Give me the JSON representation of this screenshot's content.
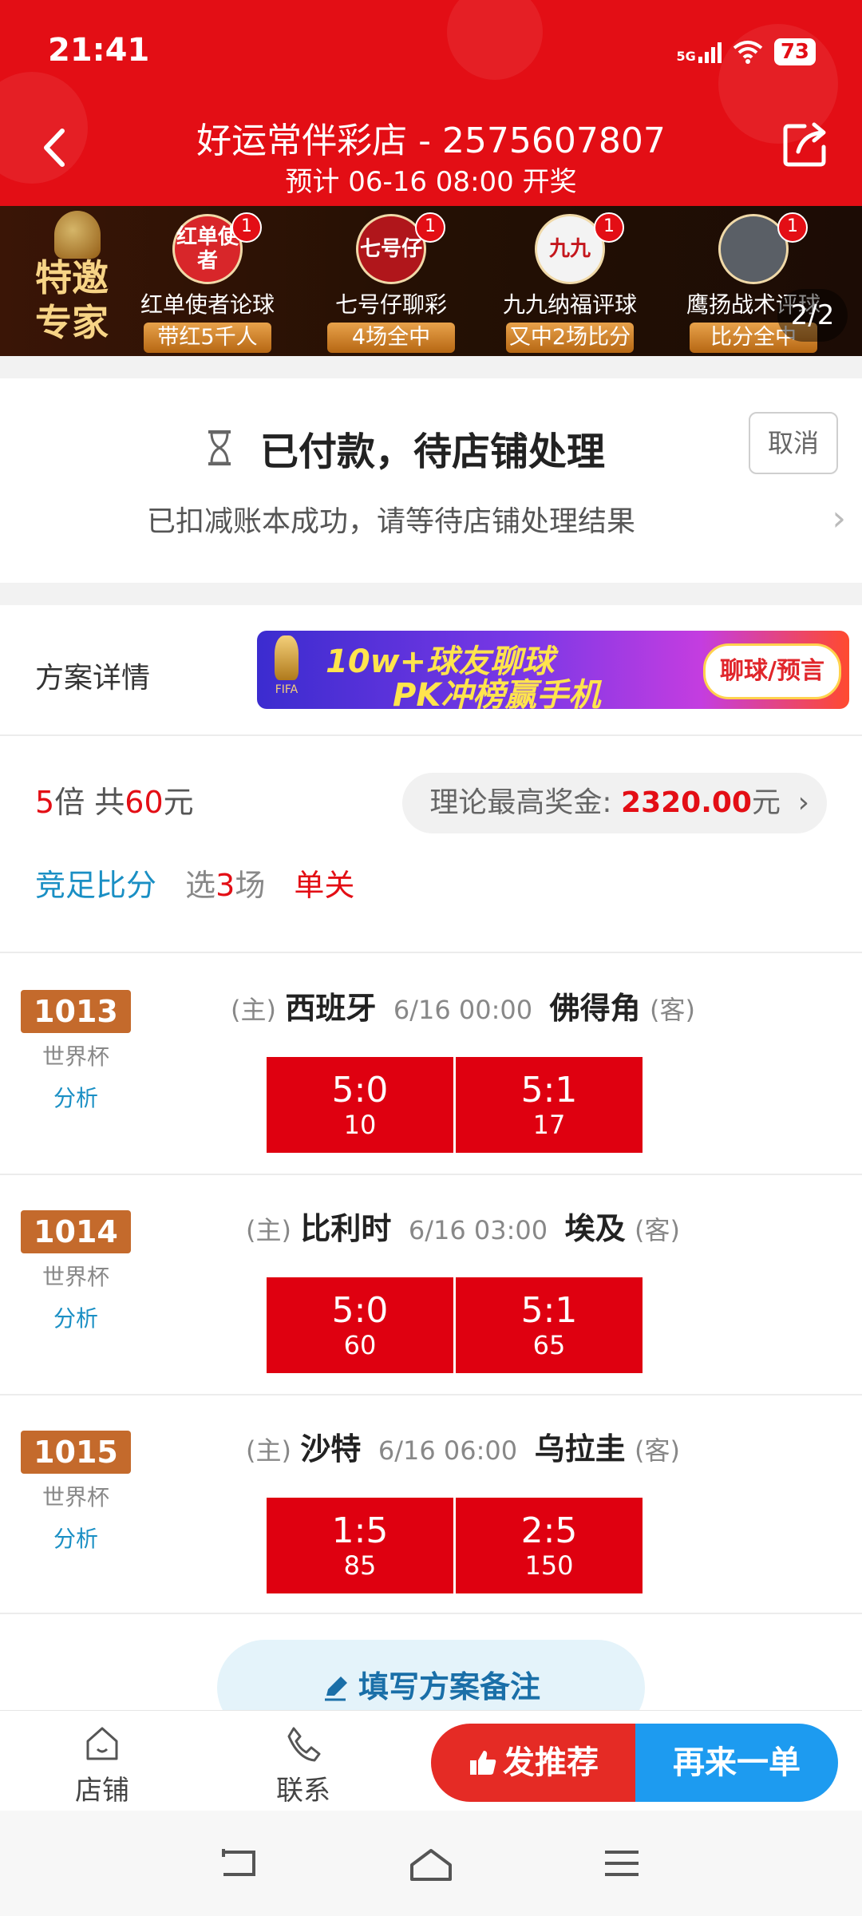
{
  "status_bar": {
    "time": "21:41",
    "network": "5G",
    "battery": "73"
  },
  "header": {
    "title": "好运常伴彩店 - 2575607807",
    "subtitle": "预计 06-16 08:00 开奖"
  },
  "experts": {
    "badge": "特邀专家",
    "items": [
      {
        "avatar_text": "红单使者",
        "count": "1",
        "name": "红单使者论球",
        "tag": "带红5千人",
        "avatar_color": "#d8262a"
      },
      {
        "avatar_text": "七号仔",
        "count": "1",
        "name": "七号仔聊彩",
        "tag": "4场全中",
        "avatar_color": "#b0161b"
      },
      {
        "avatar_text": "九九",
        "count": "1",
        "name": "九九纳福评球",
        "tag": "又中2场比分",
        "avatar_color": "#f3f3f3"
      },
      {
        "avatar_text": "",
        "count": "1",
        "name": "鹰扬战术评球",
        "tag": "比分全中",
        "avatar_color": "#5a5f66"
      }
    ],
    "pager": "2/2"
  },
  "order_status": {
    "title": "已付款，待店铺处理",
    "description": "已扣减账本成功，请等待店铺处理结果",
    "cancel_label": "取消"
  },
  "plan": {
    "section_label": "方案详情",
    "promo": {
      "line1": "10w+球友聊球",
      "line2": "PK冲榜赢手机",
      "button": "聊球/预言",
      "badge": "FIFA"
    },
    "multiple_num": "5",
    "multiple_text": "倍 共",
    "total_amount": "60",
    "total_unit": "元",
    "max_prize_label": "理论最高奖金:",
    "max_prize_amount": "2320.00",
    "max_prize_unit": "元",
    "play_type": "竞足比分",
    "select_prefix": "选",
    "select_count": "3",
    "select_suffix": "场",
    "pass_type": "单关",
    "matches": [
      {
        "number": "1013",
        "league": "世界杯",
        "analysis": "分析",
        "home_hint": "(主)",
        "home": "西班牙",
        "time": "6/16 00:00",
        "away": "佛得角",
        "away_hint": "(客)",
        "picks": [
          {
            "score": "5:0",
            "odds": "10"
          },
          {
            "score": "5:1",
            "odds": "17"
          }
        ]
      },
      {
        "number": "1014",
        "league": "世界杯",
        "analysis": "分析",
        "home_hint": "(主)",
        "home": "比利时",
        "time": "6/16 03:00",
        "away": "埃及",
        "away_hint": "(客)",
        "picks": [
          {
            "score": "5:0",
            "odds": "60"
          },
          {
            "score": "5:1",
            "odds": "65"
          }
        ]
      },
      {
        "number": "1015",
        "league": "世界杯",
        "analysis": "分析",
        "home_hint": "(主)",
        "home": "沙特",
        "time": "6/16 06:00",
        "away": "乌拉圭",
        "away_hint": "(客)",
        "picks": [
          {
            "score": "1:5",
            "odds": "85"
          },
          {
            "score": "2:5",
            "odds": "150"
          }
        ]
      }
    ],
    "remark_label": "填写方案备注"
  },
  "bottom_bar": {
    "shop_label": "店铺",
    "contact_label": "联系",
    "recommend_label": "发推荐",
    "again_label": "再来一单"
  },
  "colors": {
    "brand_red": "#e30e15",
    "odds_red": "#df0010",
    "link_blue": "#1a8fc4",
    "again_blue": "#1d9bf0"
  }
}
